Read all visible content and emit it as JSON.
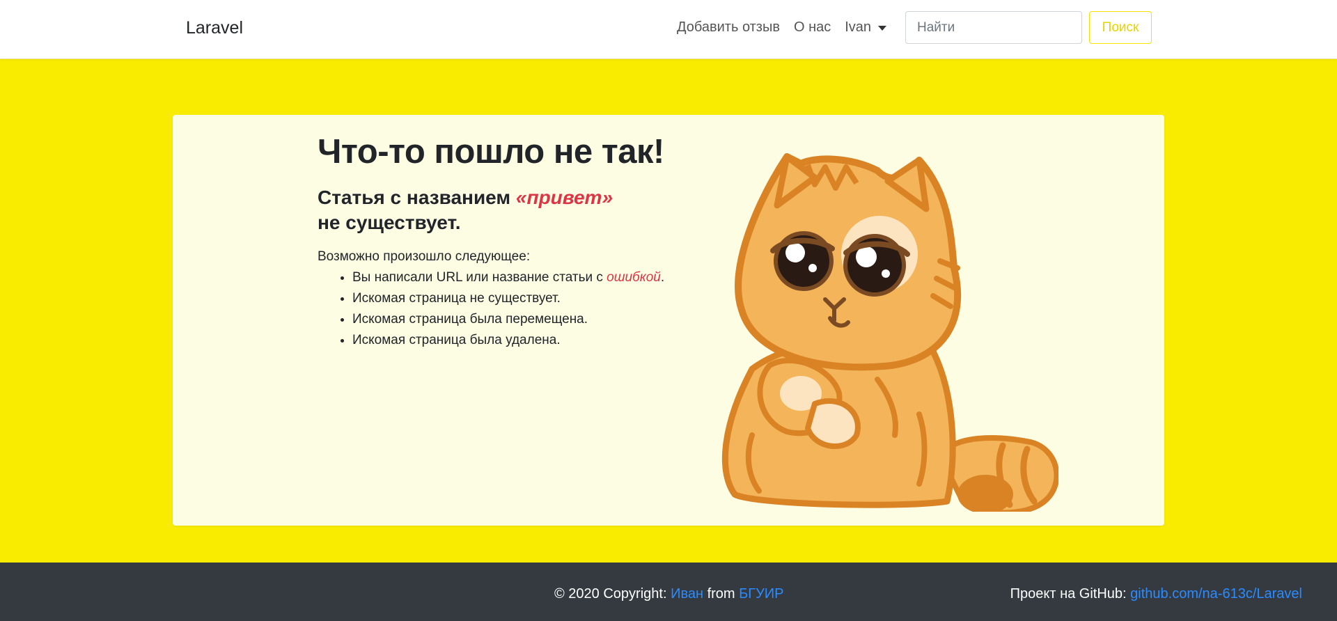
{
  "navbar": {
    "brand": "Laravel",
    "links": {
      "add_review": "Добавить отзыв",
      "about": "О нас",
      "user": "Ivan"
    },
    "search": {
      "placeholder": "Найти",
      "button": "Поиск"
    }
  },
  "error": {
    "title": "Что-то пошло не так!",
    "subtitle_prefix": "Статья с названием ",
    "article_name": "«привет»",
    "subtitle_suffix": "не существует.",
    "lead": "Возможно произошло следующее:",
    "reason1_prefix": "Вы написали URL или название статьи с ",
    "reason1_link": "ошибкой",
    "reason1_suffix": ".",
    "reason2": "Искомая страница не существует.",
    "reason3": "Искомая страница была перемещена.",
    "reason4": "Искомая страница была удалена."
  },
  "footer": {
    "copyright_prefix": "© 2020 Copyright: ",
    "author": "Иван",
    "from": " from ",
    "university": "БГУИР",
    "github_label": "Проект на GitHub: ",
    "github_link": "github.com/na-613c/Laravel"
  },
  "colors": {
    "page_bg": "#f9ec00",
    "card_bg": "#fdfde3",
    "accent_red": "#dc3545",
    "footer_bg": "#343a40",
    "link_blue": "#2b8cff",
    "cat_orange": "#f4b45a",
    "cat_stroke": "#d98325"
  },
  "icons": {
    "dropdown": "caret-down-icon",
    "illustration": "sad-cat-illustration"
  }
}
